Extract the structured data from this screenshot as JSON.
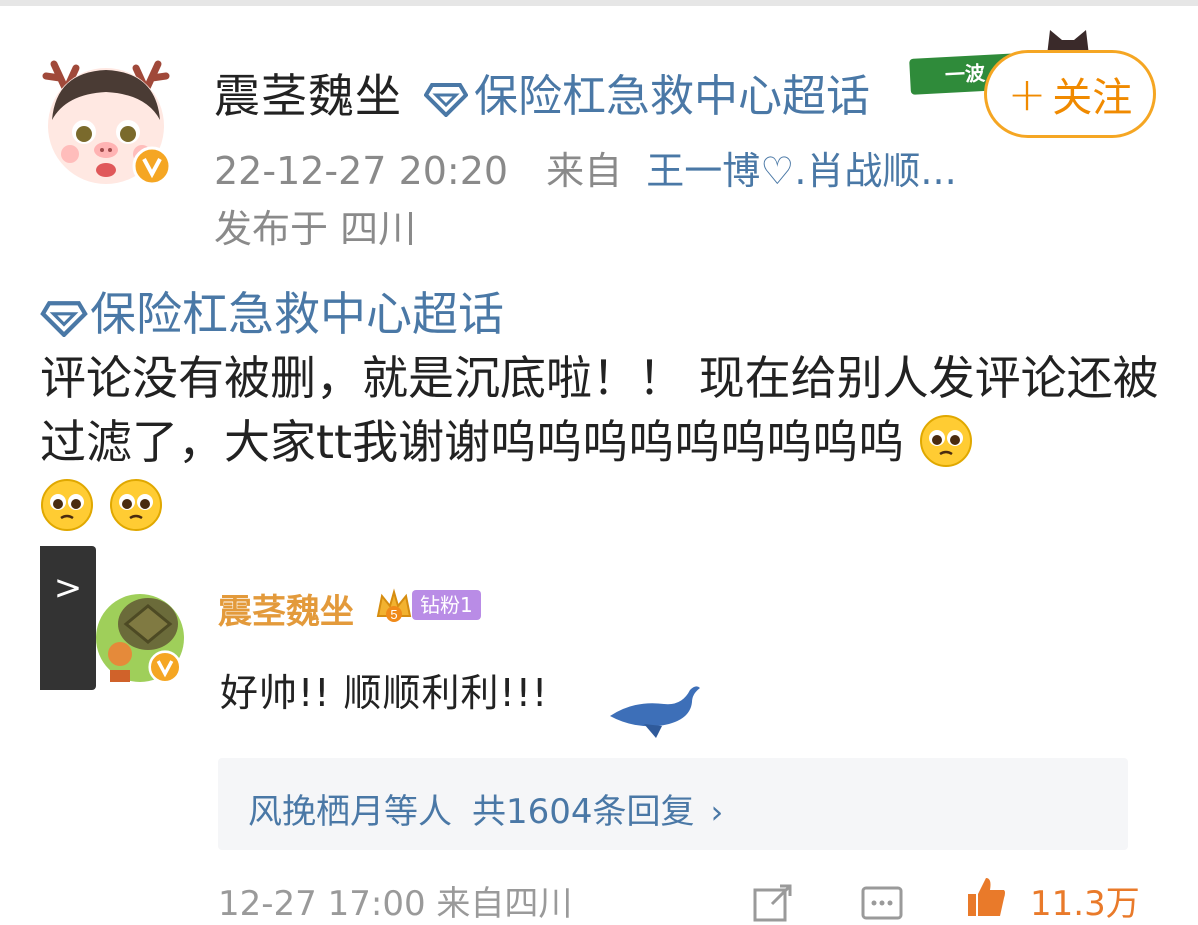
{
  "post": {
    "author": "震茎魏坐",
    "topic": "保险杠急救中心超话",
    "sticker_text": "一波",
    "follow_label": "关注",
    "follow_plus": "+",
    "datetime": "22-12-27 20:20",
    "from_label": "来自",
    "source": "王一博♡.肖战顺...",
    "location": "发布于 四川",
    "body_topic": "保险杠急救中心超话",
    "text": "评论没有被删，就是沉底啦！！ 现在给别人发评论还被过滤了，大家tt我谢谢呜呜呜呜呜呜呜呜呜"
  },
  "comment": {
    "side_tab": ">",
    "author": "震茎魏坐",
    "crown_level": "5",
    "fan_badge": "钻粉1",
    "text": "好帅!! 顺顺利利!!!",
    "replies_names": "风挽栖月等人",
    "replies_count": "共1604条回复",
    "replies_chevron": "›"
  },
  "footer": {
    "meta": "12-27 17:00 来自四川",
    "like_count": "11.3万"
  },
  "colors": {
    "link_blue": "#4a78a6",
    "follow_orange": "#f08a00",
    "comment_name": "#e39a3b",
    "fan_badge": "#b98ce6",
    "meta_gray": "#8a8a8a"
  },
  "icons": {
    "topic": "diamond-icon",
    "verified": "verified-v-icon",
    "emoji": "pleading-face-emoji",
    "crown": "crown-icon",
    "whale": "whale-icon",
    "share": "share-icon",
    "comment": "comment-icon",
    "like": "thumbs-up-icon"
  }
}
